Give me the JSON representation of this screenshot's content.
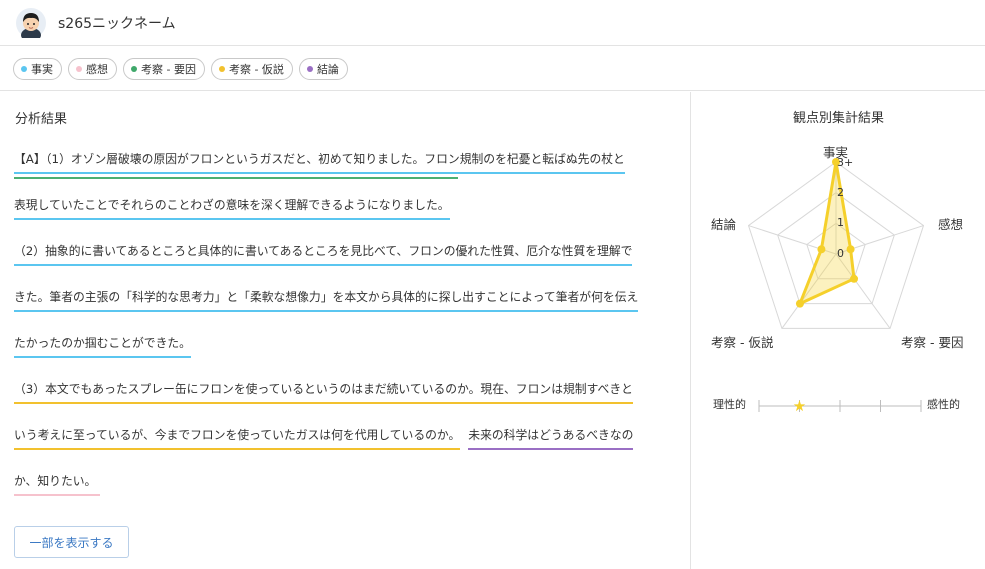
{
  "header": {
    "nickname": "s265ニックネーム"
  },
  "tags": [
    {
      "label": "事実",
      "color": "#5bc6f0"
    },
    {
      "label": "感想",
      "color": "#f6c2cd"
    },
    {
      "label": "考察 - 要因",
      "color": "#3fa86a"
    },
    {
      "label": "考察 - 仮説",
      "color": "#f2c12e"
    },
    {
      "label": "結論",
      "color": "#9a6fc4"
    }
  ],
  "analysis": {
    "title": "分析結果",
    "lines": [
      "【A】（1）オゾン層破壊の原因がフロンというガスだと、初めて知りました。フロン規制のを杞憂と転ばぬ先の杖と",
      "表現していたことでそれらのことわざの意味を深く理解できるようになりました。",
      "（2）抽象的に書いてあるところと具体的に書いてあるところを見比べて、フロンの優れた性質、厄介な性質を理解で",
      "きた。筆者の主張の「科学的な思考力」と「柔軟な想像力」を本文から具体的に探し出すことによって筆者が何を伝え",
      "たかったのか掴むことができた。",
      "（3）本文でもあったスプレー缶にフロンを使っているというのはまだ続いているのか。現在、フロンは規制すべきと",
      "いう考えに至っているが、今までフロンを使っていたガスは何を代用しているのか。",
      "未来の科学はどうあるべきなの",
      "か、知りたい。"
    ],
    "show_button": "一部を表示する"
  },
  "radar": {
    "title": "観点別集計結果",
    "axes": [
      "事実",
      "感想",
      "考察 - 要因",
      "考察 - 仮説",
      "結論"
    ],
    "scale_labels": [
      "0",
      "1",
      "2",
      "3+"
    ],
    "max": 3,
    "fill_color": "#f5d02b"
  },
  "chart_data": {
    "type": "radar",
    "title": "観点別集計結果",
    "categories": [
      "事実",
      "感想",
      "考察 - 要因",
      "考察 - 仮説",
      "結論"
    ],
    "values": [
      3,
      0.5,
      1,
      2,
      0.5
    ],
    "scale": [
      "0",
      "1",
      "2",
      "3+"
    ],
    "range": [
      0,
      3
    ]
  },
  "rationality": {
    "left_label": "理性的",
    "right_label": "感性的",
    "position": 0.25,
    "ticks": 5
  }
}
